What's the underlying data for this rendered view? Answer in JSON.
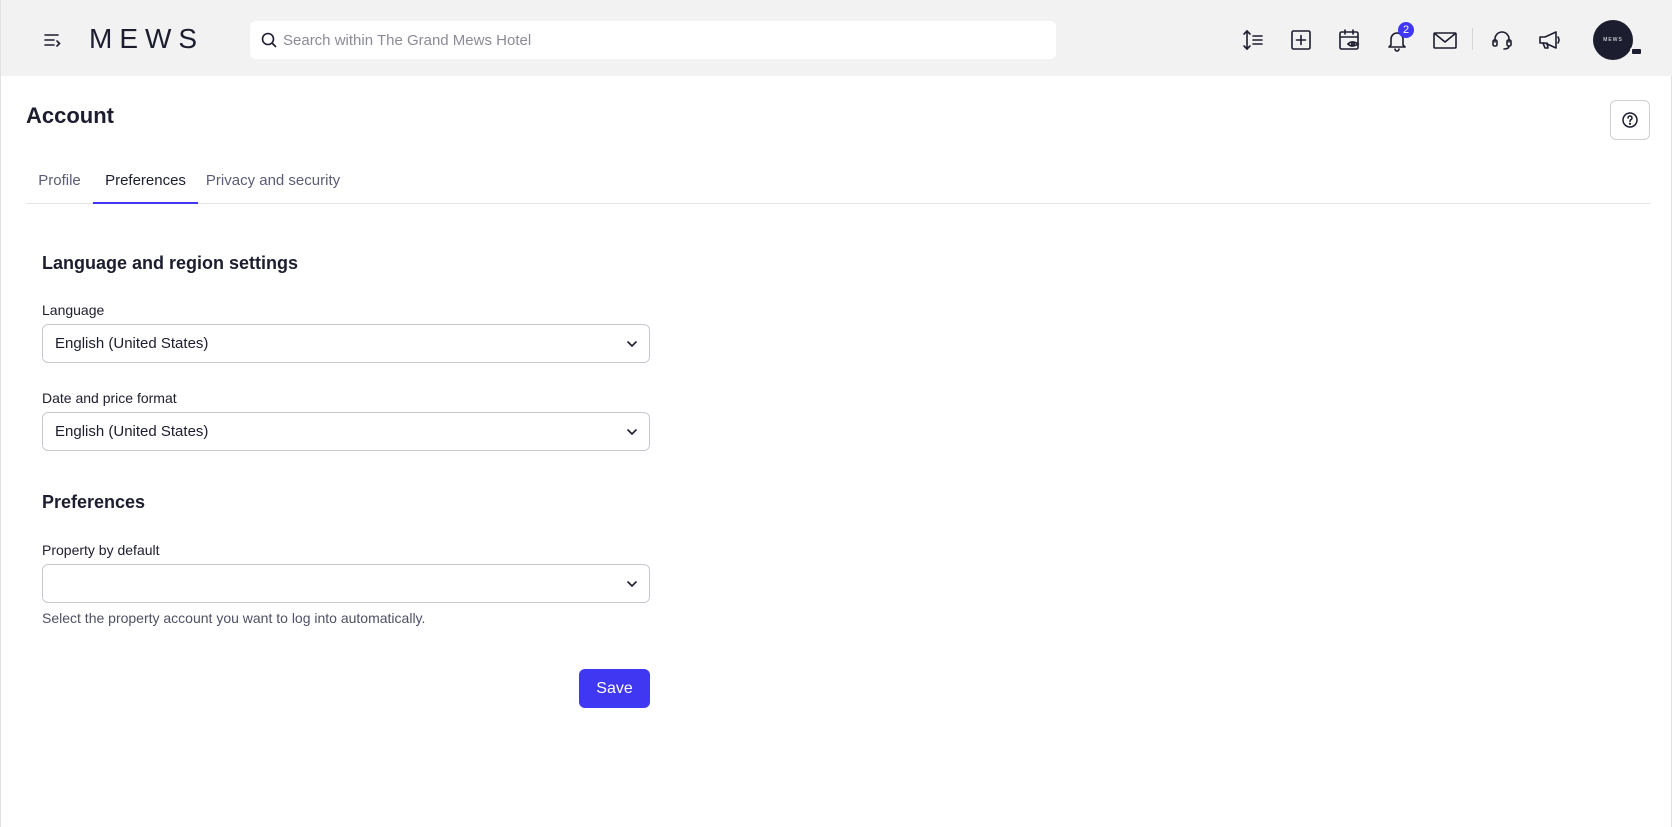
{
  "header": {
    "logo_text": "MEWS",
    "search": {
      "placeholder": "Search within The Grand Mews Hotel",
      "value": ""
    },
    "icons": [
      "menu-collapse-icon",
      "sort-lines-icon",
      "add-square-icon",
      "calendar-eye-icon",
      "bell-icon",
      "mail-icon",
      "headset-icon",
      "megaphone-icon"
    ],
    "notification_count": "2",
    "avatar_text": "MEWS"
  },
  "page": {
    "title": "Account",
    "tabs": [
      {
        "label": "Profile",
        "active": false
      },
      {
        "label": "Preferences",
        "active": true
      },
      {
        "label": "Privacy and security",
        "active": false
      }
    ]
  },
  "form": {
    "language_section": {
      "title": "Language and region settings",
      "language": {
        "label": "Language",
        "value": "English (United States)"
      },
      "date_price_format": {
        "label": "Date and price format",
        "value": "English (United States)"
      }
    },
    "preferences_section": {
      "title": "Preferences",
      "property_default": {
        "label": "Property by default",
        "value": "",
        "helper": "Select the property account you want to log into automatically."
      }
    },
    "save_label": "Save"
  },
  "colors": {
    "accent": "#3f37f2",
    "topbar_bg": "#f2f2f3",
    "text_primary": "#1c1d2e",
    "text_secondary": "#5b5c76"
  }
}
